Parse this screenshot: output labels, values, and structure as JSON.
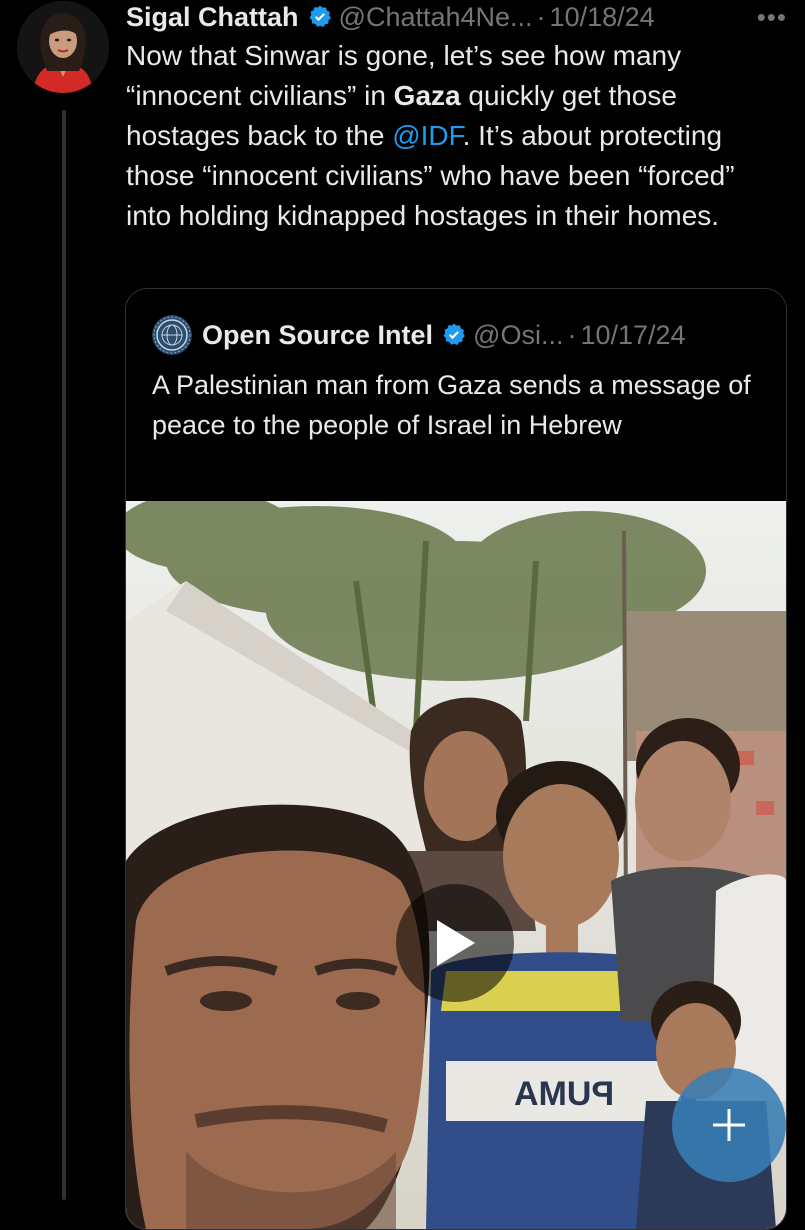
{
  "tweet": {
    "author_name": "Sigal Chattah",
    "handle": "@Chattah4Ne...",
    "separator": "·",
    "date": "10/18/24",
    "more_label": "•••",
    "text": {
      "p1": "Now that Sinwar is gone, let’s see how many “innocent civilians” in ",
      "bold": "Gaza",
      "p2": " quickly get those hostages back to the ",
      "mention": "@IDF",
      "p3": ".  It’s about protecting those “innocent civilians” who have been “forced” into holding kidnapped hostages in their homes."
    }
  },
  "quote": {
    "author_name": "Open Source Intel",
    "handle": "@Osi...",
    "separator": "·",
    "date": "10/17/24",
    "text": "A Palestinian man from Gaza sends a message of peace to the people of Israel in Hebrew",
    "media": {
      "shirt_print": "PUMA",
      "play_icon": "play-icon"
    }
  },
  "fab": {
    "icon": "plus-icon"
  },
  "colors": {
    "background": "#000000",
    "text": "#e7e9ea",
    "muted": "#71767b",
    "link": "#1d9bf0",
    "verified": "#1d9bf0",
    "border": "#2f3336"
  }
}
